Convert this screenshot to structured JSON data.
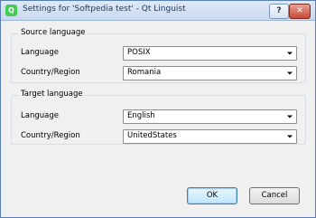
{
  "window": {
    "title": "Settings for 'Softpedia test' - Qt Linguist"
  },
  "titlebar": {
    "help_label": "?",
    "close_label": "✕"
  },
  "source": {
    "group_label": "Source language",
    "language_label": "Language",
    "language_value": "POSIX",
    "country_label": "Country/Region",
    "country_value": "Romania"
  },
  "target": {
    "group_label": "Target language",
    "language_label": "Language",
    "language_value": "English",
    "country_label": "Country/Region",
    "country_value": "UnitedStates"
  },
  "buttons": {
    "ok_label": "OK",
    "cancel_label": "Cancel"
  }
}
